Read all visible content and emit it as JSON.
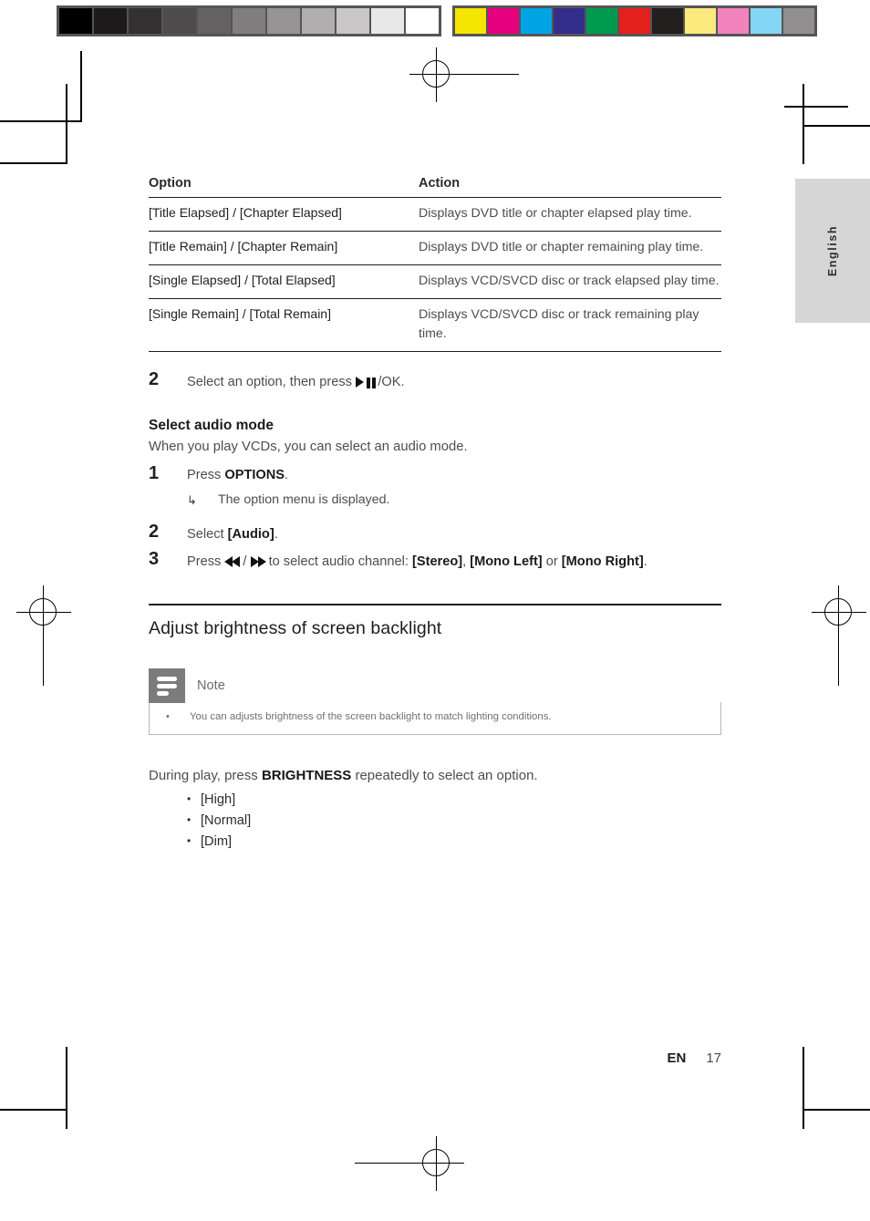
{
  "calibration_bar": {
    "grayscale": [
      "#000000",
      "#1c1a1a",
      "#333131",
      "#4d4b4b",
      "#636161",
      "#807e7e",
      "#969494",
      "#b0aeae",
      "#c9c7c7",
      "#e9e8e8",
      "#ffffff"
    ],
    "colors": [
      "#f5e500",
      "#e5007d",
      "#00a4e4",
      "#332e8c",
      "#009a4e",
      "#e3201b",
      "#231f1f",
      "#fbeb7e",
      "#f283bd",
      "#84d6f7",
      "#918f8f"
    ],
    "frame_color": "#555555"
  },
  "language_tab": {
    "label": "English",
    "background": "#d6d6d6"
  },
  "table": {
    "headers": [
      "Option",
      "Action"
    ],
    "rows": [
      {
        "option": "[Title Elapsed] / [Chapter Elapsed]",
        "action": "Displays DVD title or chapter elapsed play time."
      },
      {
        "option": "[Title Remain] / [Chapter Remain]",
        "action": "Displays DVD title or chapter remaining play time."
      },
      {
        "option": "[Single Elapsed] / [Total Elapsed]",
        "action": "Displays VCD/SVCD disc or track elapsed play time."
      },
      {
        "option": "[Single Remain] / [Total Remain]",
        "action": "Displays VCD/SVCD disc or track remaining play time."
      }
    ]
  },
  "step_after_table": {
    "number": "2",
    "text_before": "Select an option, then press ",
    "text_after": "/OK."
  },
  "audio_section": {
    "title": "Select audio mode",
    "intro": "When you play VCDs, you can select an audio mode.",
    "steps": [
      {
        "number": "1",
        "text_before": "Press ",
        "bold": "OPTIONS",
        "text_after": ".",
        "substep": "The option menu is displayed."
      },
      {
        "number": "2",
        "text_before": "Select ",
        "bold": "[Audio]",
        "text_after": "."
      },
      {
        "number": "3",
        "text_before": "Press ",
        "text_mid": " to select audio channel: ",
        "bold_1": "[Stereo]",
        "sep_1": ", ",
        "bold_2": "[Mono Left]",
        "sep_2": " or ",
        "bold_3": "[Mono Right]",
        "text_after": "."
      }
    ]
  },
  "backlight_section": {
    "title": "Adjust brightness of screen backlight",
    "note": {
      "label": "Note",
      "bullet": "•",
      "text": "You can adjusts brightness of the screen backlight to match lighting conditions."
    },
    "closing_before": "During play, press ",
    "closing_bold": "BRIGHTNESS",
    "closing_after": " repeatedly to select an option.",
    "bullet_symbol": "•",
    "options": [
      "[High]",
      "[Normal]",
      "[Dim]"
    ]
  },
  "footer": {
    "language_code": "EN",
    "page_number": "17"
  }
}
